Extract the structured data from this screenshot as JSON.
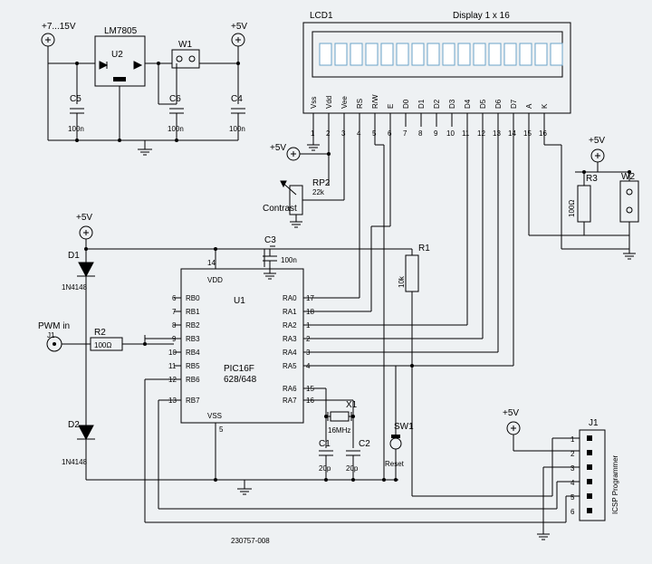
{
  "labels": {
    "vin": "+7...15V",
    "v5_top": "+5V",
    "v5_lcd": "+5V",
    "v5_right": "+5V",
    "v5_mid": "+5V",
    "v5_icsp": "+5V",
    "lm7805": "LM7805",
    "u2": "U2",
    "w1": "W1",
    "w2": "W2",
    "c5": "C5",
    "c6": "C6",
    "c4": "C4",
    "c3": "C3",
    "c1": "C1",
    "c2": "C2",
    "hundred_n": "100n",
    "d1": "D1",
    "d2": "D2",
    "diode_pn": "1N4148",
    "pwmin": "PWM in",
    "j1": "J1",
    "j1b": "J1",
    "r2": "R2",
    "r2v": "100Ω",
    "r3": "R3",
    "r3v": "100Ω",
    "r1": "R1",
    "r1v": "10k",
    "rp2": "RP2",
    "rp2v": "22k",
    "contrast": "Contrast",
    "u1": "U1",
    "pic": "PIC16F\n628/648",
    "vdd": "VDD",
    "vss": "VSS",
    "rb0": "RB0",
    "rb1": "RB1",
    "rb2": "RB2",
    "rb3": "RB3",
    "rb4": "RB4",
    "rb5": "RB5",
    "rb6": "RB6",
    "rb7": "RB7",
    "ra0": "RA0",
    "ra1": "RA1",
    "ra2": "RA2",
    "ra3": "RA3",
    "ra4": "RA4",
    "ra5": "RA5",
    "ra6": "RA6",
    "ra7": "RA7",
    "x1": "X1",
    "x1v": "16MHz",
    "twenty_p": "20p",
    "sw1": "SW1",
    "reset": "Reset",
    "icsp": "ICSP Programmer",
    "lcd1": "LCD1",
    "disp": "Display 1 x 16",
    "pin_vss": "Vss",
    "pin_vdd": "Vdd",
    "pin_vee": "Vee",
    "pin_rs": "RS",
    "pin_rw": "R/W",
    "pin_e": "E",
    "pin_d0": "D0",
    "pin_d1": "D1",
    "pin_d2": "D2",
    "pin_d3": "D3",
    "pin_d4": "D4",
    "pin_d5": "D5",
    "pin_d6": "D6",
    "pin_d7": "D7",
    "pin_a": "A",
    "pin_k": "K",
    "p14": "14",
    "p5": "5",
    "p6": "6",
    "p7": "7",
    "p8": "8",
    "p9": "9",
    "p10": "10",
    "p11": "11",
    "p12": "12",
    "p13": "13",
    "p17": "17",
    "p18": "18",
    "p1": "1",
    "p2": "2",
    "p3": "3",
    "p4": "4",
    "p15": "15",
    "p16": "16",
    "lcd_n1": "1",
    "lcd_n2": "2",
    "lcd_n3": "3",
    "lcd_n4": "4",
    "lcd_n5": "5",
    "lcd_n6": "6",
    "lcd_n7": "7",
    "lcd_n8": "8",
    "lcd_n9": "9",
    "lcd_n10": "10",
    "lcd_n11": "11",
    "lcd_n12": "12",
    "lcd_n13": "13",
    "lcd_n14": "14",
    "lcd_n15": "15",
    "lcd_n16": "16",
    "icsp_n1": "1",
    "icsp_n2": "2",
    "icsp_n3": "3",
    "icsp_n4": "4",
    "icsp_n5": "5",
    "icsp_n6": "6",
    "drawing_no": "230757-008"
  }
}
